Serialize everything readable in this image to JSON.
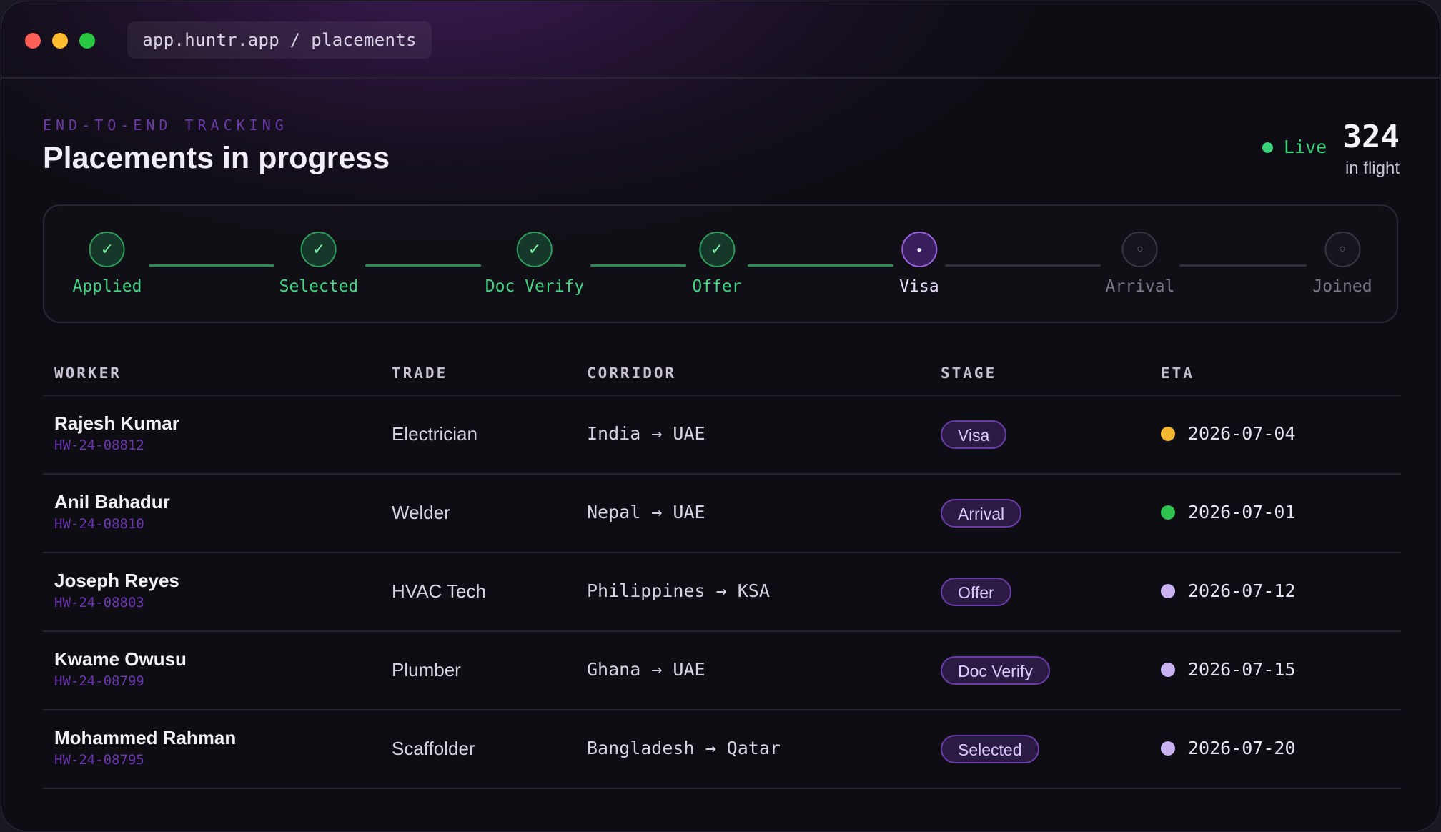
{
  "window": {
    "url": "app.huntr.app / placements"
  },
  "header": {
    "eyebrow": "END-TO-END TRACKING",
    "title": "Placements in progress",
    "live_label": "Live",
    "count": "324",
    "count_label": "in flight"
  },
  "colors": {
    "done": "#3ad27a",
    "current": "#9a62e0",
    "accent": "#6b36b0",
    "amber": "#f5b731",
    "green": "#2fc24e",
    "lavender": "#c9b2f2"
  },
  "stages": [
    {
      "label": "Applied",
      "state": "done",
      "icon": "check-icon",
      "glyph": "✓"
    },
    {
      "label": "Selected",
      "state": "done",
      "icon": "check-icon",
      "glyph": "✓"
    },
    {
      "label": "Doc Verify",
      "state": "done",
      "icon": "check-icon",
      "glyph": "✓"
    },
    {
      "label": "Offer",
      "state": "done",
      "icon": "check-icon",
      "glyph": "✓"
    },
    {
      "label": "Visa",
      "state": "current",
      "icon": "dot-icon",
      "glyph": "●"
    },
    {
      "label": "Arrival",
      "state": "future",
      "icon": "circle-icon",
      "glyph": "○"
    },
    {
      "label": "Joined",
      "state": "future",
      "icon": "circle-icon",
      "glyph": "○"
    }
  ],
  "table": {
    "columns": [
      "WORKER",
      "TRADE",
      "CORRIDOR",
      "STAGE",
      "ETA"
    ],
    "rows": [
      {
        "name": "Rajesh Kumar",
        "id": "HW-24-08812",
        "trade": "Electrician",
        "corridor": "India → UAE",
        "stage": "Visa",
        "eta": "2026-07-04",
        "eta_color": "#f5b731"
      },
      {
        "name": "Anil Bahadur",
        "id": "HW-24-08810",
        "trade": "Welder",
        "corridor": "Nepal → UAE",
        "stage": "Arrival",
        "eta": "2026-07-01",
        "eta_color": "#2fc24e"
      },
      {
        "name": "Joseph Reyes",
        "id": "HW-24-08803",
        "trade": "HVAC Tech",
        "corridor": "Philippines → KSA",
        "stage": "Offer",
        "eta": "2026-07-12",
        "eta_color": "#c9b2f2"
      },
      {
        "name": "Kwame Owusu",
        "id": "HW-24-08799",
        "trade": "Plumber",
        "corridor": "Ghana → UAE",
        "stage": "Doc Verify",
        "eta": "2026-07-15",
        "eta_color": "#c9b2f2"
      },
      {
        "name": "Mohammed Rahman",
        "id": "HW-24-08795",
        "trade": "Scaffolder",
        "corridor": "Bangladesh → Qatar",
        "stage": "Selected",
        "eta": "2026-07-20",
        "eta_color": "#c9b2f2"
      }
    ]
  }
}
